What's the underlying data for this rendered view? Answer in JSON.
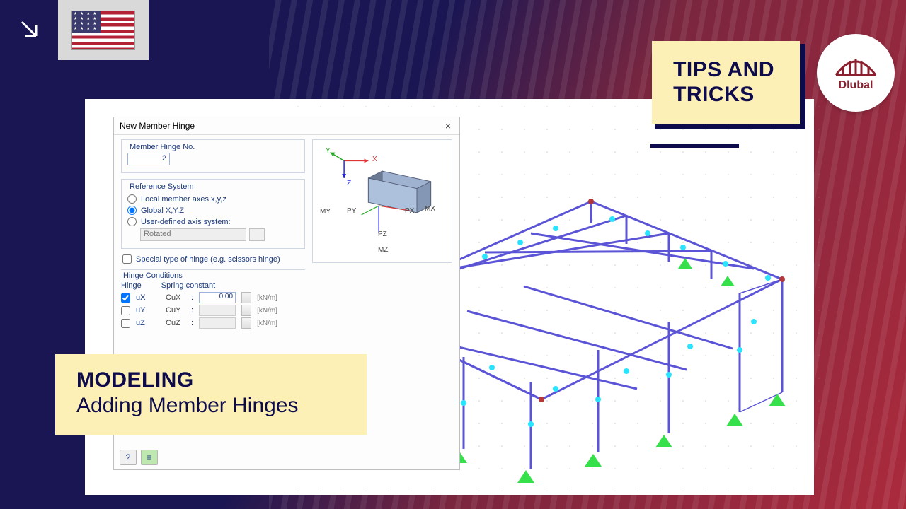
{
  "badges": {
    "tips_line1": "TIPS AND",
    "tips_line2": "TRICKS",
    "kicker": "MODELING",
    "subtitle": "Adding Member Hinges",
    "logo_text": "Dlubal"
  },
  "dialog": {
    "title": "New Member Hinge",
    "section_no": "Member Hinge No.",
    "hinge_no_value": "2",
    "ref_sys": {
      "legend": "Reference System",
      "opt_local": "Local member axes x,y,z",
      "opt_global": "Global X,Y,Z",
      "opt_user": "User-defined axis system:",
      "rot_label": "Rotated"
    },
    "special_label": "Special type of hinge (e.g. scissors hinge)",
    "hinge_cond": {
      "legend": "Hinge Conditions",
      "col_hinge": "Hinge",
      "col_spring": "Spring constant",
      "rows": [
        {
          "chk": true,
          "name": "uX",
          "sym": "CuX",
          "val": "0.00",
          "unit": "[kN/m]",
          "enabled": true
        },
        {
          "chk": false,
          "name": "uY",
          "sym": "CuY",
          "val": "",
          "unit": "[kN/m]",
          "enabled": false
        },
        {
          "chk": false,
          "name": "uZ",
          "sym": "CuZ",
          "val": "",
          "unit": "[kN/m]",
          "enabled": false
        }
      ]
    },
    "preview": {
      "axes": {
        "x": "X",
        "y": "Y",
        "z": "Z"
      },
      "moments": {
        "my": "MY",
        "mx": "MX",
        "mz": "MZ",
        "py": "PY",
        "px": "PX",
        "pz": "PZ"
      }
    }
  }
}
